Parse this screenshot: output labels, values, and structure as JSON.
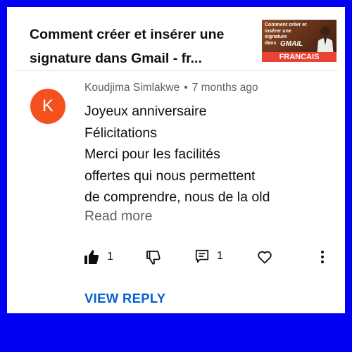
{
  "video": {
    "title": "Comment créer et insérer une signature dans Gmail - fr...",
    "thumbnail": {
      "caption_lines": [
        "Comment créer et",
        "insérer une signature",
        "dans"
      ],
      "brand": "GMAIL",
      "banner": "FRANCAIS"
    }
  },
  "comment": {
    "avatar_letter": "K",
    "avatar_color": "#f4511e",
    "author": "Koudjima Simlakwe",
    "separator": "•",
    "time_ago": "7 months ago",
    "lines": [
      "Joyeux anniversaire",
      "Félicitations",
      "Merci pour les facilités",
      "offertes qui nous permettent",
      "de comprendre, nous de la old"
    ],
    "read_more": "Read more",
    "actions": {
      "like_count": "1",
      "reply_count": "1"
    },
    "view_reply": "VIEW REPLY"
  },
  "colors": {
    "frame": "#0000f5",
    "link": "#065fd4"
  }
}
